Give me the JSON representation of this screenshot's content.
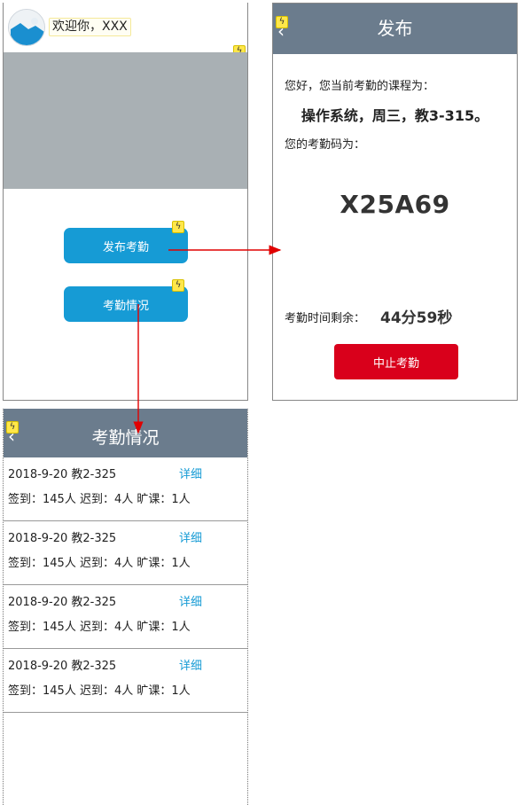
{
  "home": {
    "welcome": "欢迎你，XXX",
    "buttons": {
      "publish": "发布考勤",
      "status": "考勤情况"
    }
  },
  "publish": {
    "title": "发布",
    "greeting": "您好，您当前考勤的课程为：",
    "course": "操作系统，周三，教3-315。",
    "code_label": "您的考勤码为：",
    "code": "X25A69",
    "remaining_label": "考勤时间剩余：",
    "remaining_value": "44分59秒",
    "stop_button": "中止考勤"
  },
  "list": {
    "title": "考勤情况",
    "detail_label": "详细",
    "rows": [
      {
        "date_room": "2018-9-20  教2-325",
        "stats": "签到：145人 迟到：4人  旷课：1人"
      },
      {
        "date_room": "2018-9-20  教2-325",
        "stats": "签到：145人 迟到：4人  旷课：1人"
      },
      {
        "date_room": "2018-9-20  教2-325",
        "stats": "签到：145人 迟到：4人  旷课：1人"
      },
      {
        "date_room": "2018-9-20  教2-325",
        "stats": "签到：145人 迟到：4人  旷课：1人"
      }
    ]
  },
  "colors": {
    "primary": "#169bd5",
    "danger": "#d9001b",
    "topbar": "#6b7c8d",
    "banner": "#a9b0b4",
    "arrow": "#e00000"
  },
  "icons": {
    "avatar": "avatar-image-icon",
    "back": "back-chevron-icon",
    "interaction": "lightning-flag-icon"
  }
}
